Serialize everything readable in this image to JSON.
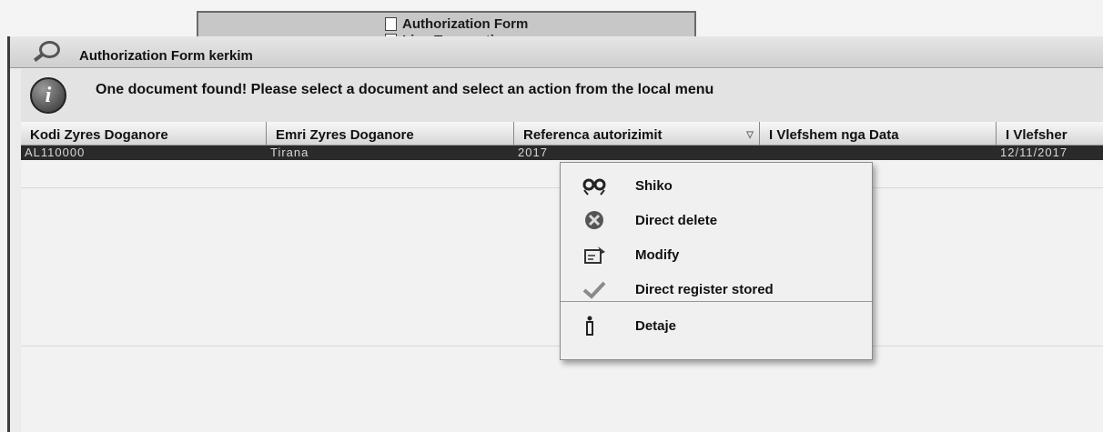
{
  "top_menu": {
    "items": [
      {
        "label": "Authorization Form",
        "icon": "document-icon"
      },
      {
        "label": "Line Transaction",
        "icon": "document-icon"
      }
    ]
  },
  "window": {
    "title": "Authorization Form kerkim",
    "icon": "search-icon"
  },
  "info_bar": {
    "icon": "info-icon",
    "message": "One document found! Please select a document and select an action from the local menu"
  },
  "table": {
    "columns": [
      "Kodi Zyres Doganore",
      "Emri Zyres Doganore",
      "Referenca autorizimit",
      "I Vlefshem nga Data",
      "I Vlefsher"
    ],
    "rows": [
      [
        "AL110000",
        "Tirana",
        "2017",
        "",
        "12/11/2017"
      ]
    ]
  },
  "context_menu": {
    "items": [
      {
        "label": "Shiko",
        "icon": "view-icon"
      },
      {
        "label": "Direct delete",
        "icon": "delete-icon"
      },
      {
        "label": "Modify",
        "icon": "modify-icon"
      },
      {
        "label": "Direct register stored",
        "icon": "checkmark-icon"
      },
      {
        "label": "Detaje",
        "icon": "details-icon"
      }
    ]
  }
}
